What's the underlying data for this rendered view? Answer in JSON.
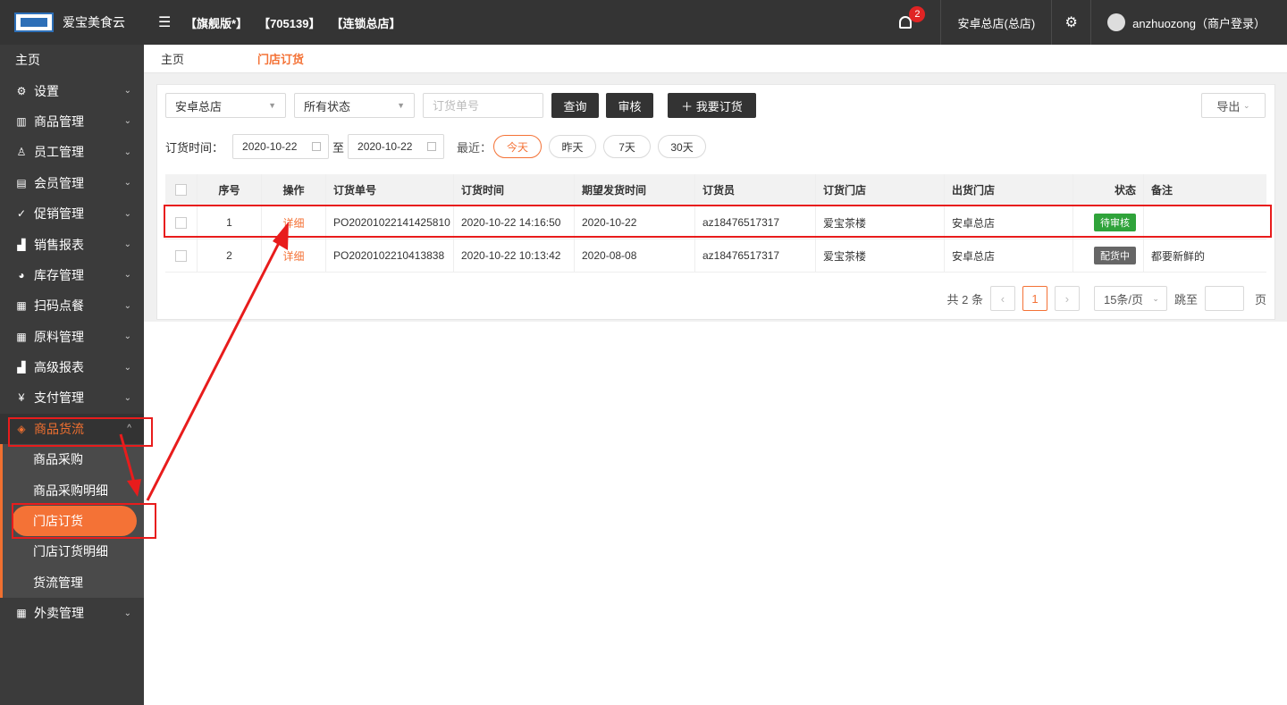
{
  "topbar": {
    "brand": "爱宝美食云",
    "tags": [
      "【旗舰版*】",
      "【705139】",
      "【连锁总店】"
    ],
    "notification_count": "2",
    "store": "安卓总店(总店)",
    "user": "anzhuozong（商户登录）"
  },
  "sidebar": {
    "home": "主页",
    "items": [
      {
        "label": "设置",
        "icon": "gear-icon"
      },
      {
        "label": "商品管理",
        "icon": "barcode-icon"
      },
      {
        "label": "员工管理",
        "icon": "user-icon"
      },
      {
        "label": "会员管理",
        "icon": "member-card-icon"
      },
      {
        "label": "促销管理",
        "icon": "check-circle-icon"
      },
      {
        "label": "销售报表",
        "icon": "bar-chart-icon"
      },
      {
        "label": "库存管理",
        "icon": "pie-chart-icon"
      },
      {
        "label": "扫码点餐",
        "icon": "store-icon"
      },
      {
        "label": "原料管理",
        "icon": "store-icon"
      },
      {
        "label": "高级报表",
        "icon": "bar-chart-icon"
      },
      {
        "label": "支付管理",
        "icon": "yen-icon"
      }
    ],
    "open_group": {
      "label": "商品货流",
      "icon": "cube-icon"
    },
    "sub_items": [
      "商品采购",
      "商品采购明细",
      "门店订货",
      "门店订货明细",
      "货流管理"
    ],
    "last_item": {
      "label": "外卖管理",
      "icon": "store-icon"
    }
  },
  "breadcrumb": {
    "home": "主页",
    "current": "门店订货"
  },
  "filters": {
    "store_select": "安卓总店",
    "status_select": "所有状态",
    "order_no_placeholder": "订货单号",
    "query": "查询",
    "review": "审核",
    "my_order": "我要订货",
    "export": "导出",
    "time_label": "订货时间：",
    "date_from": "2020-10-22",
    "to": "至",
    "date_to": "2020-10-22",
    "recent_label": "最近：",
    "quick": [
      "今天",
      "昨天",
      "7天",
      "30天"
    ]
  },
  "table": {
    "headers": [
      "序号",
      "操作",
      "订货单号",
      "订货时间",
      "期望发货时间",
      "订货员",
      "订货门店",
      "出货门店",
      "状态",
      "备注"
    ],
    "rows": [
      {
        "no": "1",
        "action": "详细",
        "order_no": "PO20201022141425810",
        "order_time": "2020-10-22 14:16:50",
        "expected": "2020-10-22",
        "clerk": "az18476517317",
        "to_store": "爱宝茶楼",
        "from_store": "安卓总店",
        "status": "待审核",
        "status_color": "#2fa33a",
        "note": ""
      },
      {
        "no": "2",
        "action": "详细",
        "order_no": "PO2020102210413838",
        "order_time": "2020-10-22 10:13:42",
        "expected": "2020-08-08",
        "clerk": "az18476517317",
        "to_store": "爱宝茶楼",
        "from_store": "安卓总店",
        "status": "配货中",
        "status_color": "#666666",
        "note": "都要新鲜的"
      }
    ]
  },
  "pager": {
    "total": "共 2 条",
    "current": "1",
    "page_size": "15条/页",
    "jump": "跳至",
    "page_unit": "页"
  },
  "colors": {
    "accent": "#f47236",
    "annotation": "#e81c1c",
    "topbar": "#343434",
    "sidebar": "#3b3b3b"
  }
}
